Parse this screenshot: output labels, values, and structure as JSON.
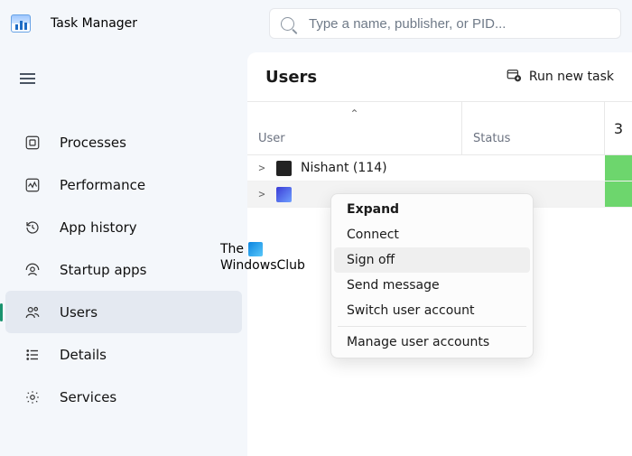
{
  "app": {
    "title": "Task Manager",
    "search_placeholder": "Type a name, publisher, or PID..."
  },
  "sidebar": {
    "items": [
      {
        "label": "Processes",
        "icon": "processes-icon"
      },
      {
        "label": "Performance",
        "icon": "performance-icon"
      },
      {
        "label": "App history",
        "icon": "history-icon"
      },
      {
        "label": "Startup apps",
        "icon": "startup-icon"
      },
      {
        "label": "Users",
        "icon": "users-icon",
        "selected": true
      },
      {
        "label": "Details",
        "icon": "details-icon"
      },
      {
        "label": "Services",
        "icon": "services-icon"
      }
    ]
  },
  "content": {
    "title": "Users",
    "run_new_task": "Run new task",
    "columns": {
      "user": "User",
      "status": "Status",
      "third_partial": "3"
    },
    "rows": [
      {
        "name": "Nishant (114)",
        "avatar": "dark"
      },
      {
        "name": "",
        "avatar": "blue",
        "hovered": true
      }
    ]
  },
  "context_menu": {
    "items": [
      {
        "label": "Expand",
        "bold": true
      },
      {
        "label": "Connect"
      },
      {
        "label": "Sign off",
        "hover": true
      },
      {
        "label": "Send message"
      },
      {
        "label": "Switch user account"
      }
    ],
    "footer": {
      "label": "Manage user accounts"
    }
  },
  "watermark": {
    "line1": "The",
    "line2": "WindowsClub"
  }
}
